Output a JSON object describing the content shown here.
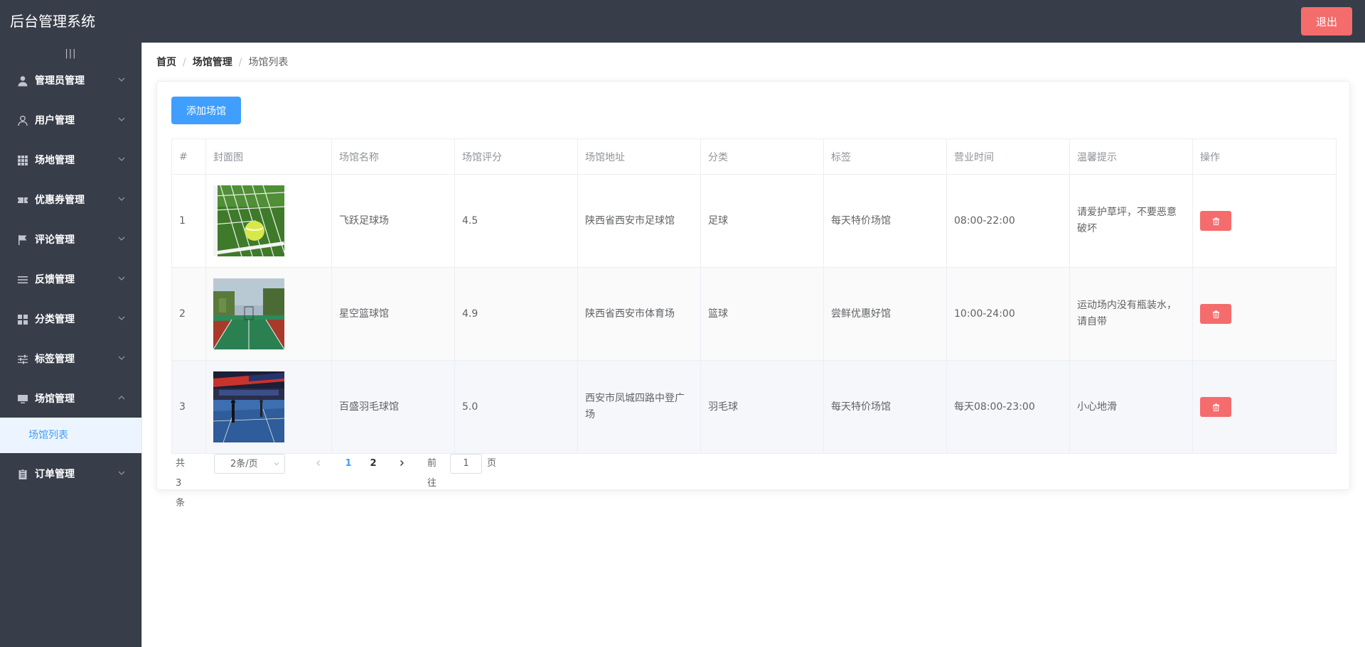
{
  "app": {
    "title": "后台管理系统",
    "logout_label": "退出"
  },
  "sidebar": {
    "toggle_glyph": "|||",
    "items": [
      {
        "label": "管理员管理",
        "icon": "user-filled-icon",
        "expanded": false
      },
      {
        "label": "用户管理",
        "icon": "user-icon",
        "expanded": false
      },
      {
        "label": "场地管理",
        "icon": "grid-icon",
        "expanded": false
      },
      {
        "label": "优惠券管理",
        "icon": "ticket-icon",
        "expanded": false
      },
      {
        "label": "评论管理",
        "icon": "flag-icon",
        "expanded": false
      },
      {
        "label": "反馈管理",
        "icon": "list-icon",
        "expanded": false
      },
      {
        "label": "分类管理",
        "icon": "menu-grid-icon",
        "expanded": false
      },
      {
        "label": "标签管理",
        "icon": "sliders-icon",
        "expanded": false
      },
      {
        "label": "场馆管理",
        "icon": "monitor-icon",
        "expanded": true
      },
      {
        "label": "订单管理",
        "icon": "clipboard-icon",
        "expanded": false
      }
    ],
    "active_sub_label": "场馆列表"
  },
  "breadcrumb": [
    "首页",
    "场馆管理",
    "场馆列表"
  ],
  "toolbar": {
    "add_label": "添加场馆"
  },
  "table": {
    "columns": [
      "#",
      "封面图",
      "场馆名称",
      "场馆评分",
      "场馆地址",
      "分类",
      "标签",
      "营业时间",
      "温馨提示",
      "操作"
    ],
    "rows": [
      {
        "index": "1",
        "image": "soccer-ball-goal-image",
        "name": "飞跃足球场",
        "rating": "4.5",
        "address": "陕西省西安市足球馆",
        "category": "足球",
        "tag": "每天特价场馆",
        "hours": "08:00-22:00",
        "tip": "请爱护草坪，不要恶意破坏"
      },
      {
        "index": "2",
        "image": "basketball-court-image",
        "name": "星空篮球馆",
        "rating": "4.9",
        "address": "陕西省西安市体育场",
        "category": "篮球",
        "tag": "尝鲜优惠好馆",
        "hours": "10:00-24:00",
        "tip": "运动场内没有瓶装水，请自带"
      },
      {
        "index": "3",
        "image": "badminton-hall-image",
        "name": "百盛羽毛球馆",
        "rating": "5.0",
        "address": "西安市凤城四路中登广场",
        "category": "羽毛球",
        "tag": "每天特价场馆",
        "hours": "每天08:00-23:00",
        "tip": "小心地滑"
      }
    ]
  },
  "pagination": {
    "total": "共 3 条",
    "page_size": "2条/页",
    "pages": [
      "1",
      "2"
    ],
    "current_page": "1",
    "goto_label": "前往",
    "goto_value": "1",
    "goto_unit": "页"
  },
  "colors": {
    "sidebar": "#373d49",
    "primary": "#409eff",
    "danger": "#f56c6c",
    "active_bg": "#ecf5ff"
  }
}
